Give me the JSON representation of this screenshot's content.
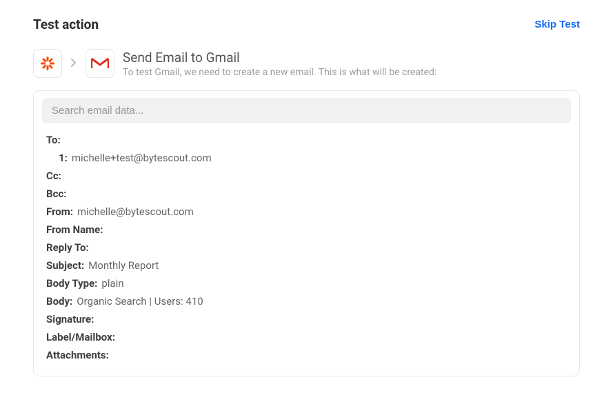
{
  "header": {
    "title": "Test action",
    "skip_label": "Skip Test"
  },
  "action": {
    "title": "Send Email to Gmail",
    "subtitle": "To test Gmail, we need to create a new email. This is what will be created:"
  },
  "search": {
    "placeholder": "Search email data..."
  },
  "fields": {
    "to_label": "To:",
    "to_index": "1:",
    "to_value": "michelle+test@bytescout.com",
    "cc_label": "Cc:",
    "cc_value": "",
    "bcc_label": "Bcc:",
    "bcc_value": "",
    "from_label": "From:",
    "from_value": "michelle@bytescout.com",
    "from_name_label": "From Name:",
    "from_name_value": "",
    "reply_to_label": "Reply To:",
    "reply_to_value": "",
    "subject_label": "Subject:",
    "subject_value": "Monthly Report",
    "body_type_label": "Body Type:",
    "body_type_value": "plain",
    "body_label": "Body:",
    "body_value": "Organic Search | Users: 410",
    "signature_label": "Signature:",
    "signature_value": "",
    "label_mailbox_label": "Label/Mailbox:",
    "label_mailbox_value": "",
    "attachments_label": "Attachments:",
    "attachments_value": ""
  }
}
